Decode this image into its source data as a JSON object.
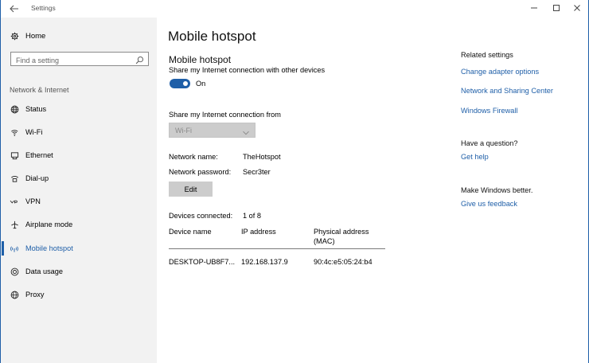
{
  "window": {
    "title": "Settings",
    "controls": {
      "minimize": "minimize-icon",
      "maximize": "maximize-icon",
      "close": "close-icon"
    }
  },
  "sidebar": {
    "home_label": "Home",
    "search_placeholder": "Find a setting",
    "section_header": "Network & Internet",
    "items": [
      {
        "label": "Status",
        "icon": "globe-icon",
        "active": false
      },
      {
        "label": "Wi-Fi",
        "icon": "wifi-icon",
        "active": false
      },
      {
        "label": "Ethernet",
        "icon": "ethernet-icon",
        "active": false
      },
      {
        "label": "Dial-up",
        "icon": "dialup-icon",
        "active": false
      },
      {
        "label": "VPN",
        "icon": "vpn-icon",
        "active": false
      },
      {
        "label": "Airplane mode",
        "icon": "airplane-icon",
        "active": false
      },
      {
        "label": "Mobile hotspot",
        "icon": "hotspot-icon",
        "active": true
      },
      {
        "label": "Data usage",
        "icon": "data-usage-icon",
        "active": false
      },
      {
        "label": "Proxy",
        "icon": "proxy-icon",
        "active": false
      }
    ]
  },
  "main": {
    "page_title": "Mobile hotspot",
    "subtitle": "Mobile hotspot",
    "share_label": "Share my Internet connection with other devices",
    "toggle_state": "On",
    "share_from_label": "Share my Internet connection from",
    "share_from_value": "Wi-Fi",
    "network_name_label": "Network name:",
    "network_name_value": "TheHotspot",
    "network_password_label": "Network password:",
    "network_password_value": "Secr3ter",
    "edit_button": "Edit",
    "devices_connected_label": "Devices connected:",
    "devices_connected_value": "1 of 8",
    "table": {
      "headers": [
        "Device name",
        "IP address",
        "Physical address (MAC)"
      ],
      "rows": [
        [
          "DESKTOP-UB8F7...",
          "192.168.137.9",
          "90:4c:e5:05:24:b4"
        ]
      ]
    }
  },
  "related": {
    "heading": "Related settings",
    "links": [
      "Change adapter options",
      "Network and Sharing Center",
      "Windows Firewall"
    ],
    "question_heading": "Have a question?",
    "help_link": "Get help",
    "better_heading": "Make Windows better.",
    "feedback_link": "Give us feedback"
  },
  "colors": {
    "accent": "#1f5fa8",
    "sidebar_bg": "#f2f2f2",
    "button_bg": "#cccccc"
  }
}
